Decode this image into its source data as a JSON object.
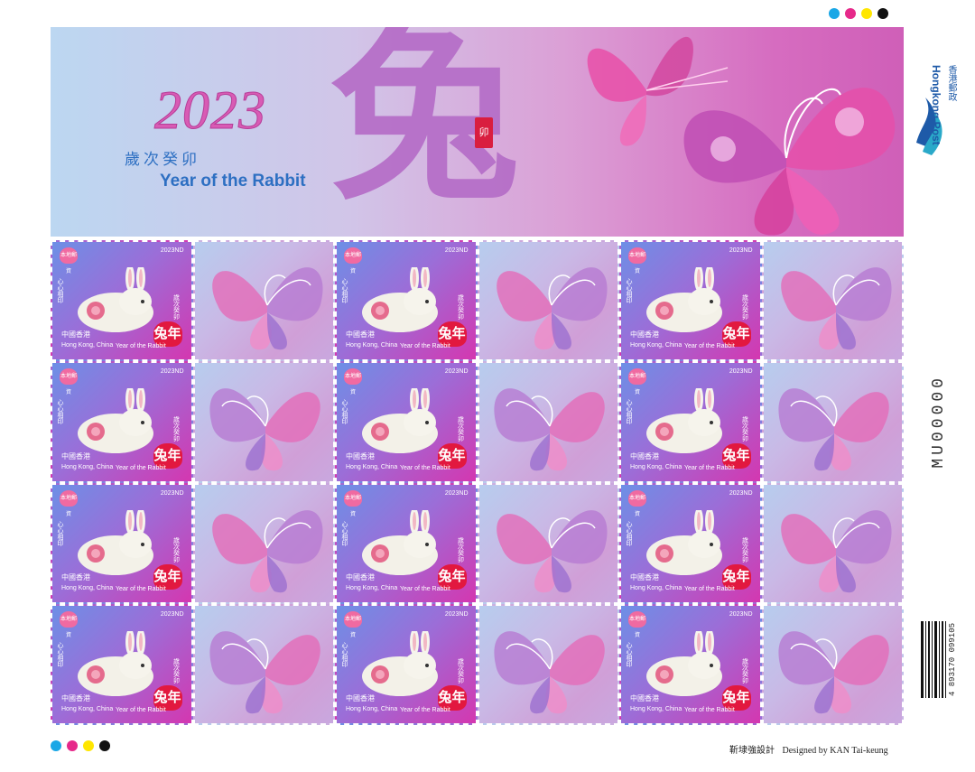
{
  "header": {
    "year": "2023",
    "cn_subtitle": "歲次癸卯",
    "en_subtitle": "Year of the Rabbit",
    "big_character": "兔",
    "seal_text": "卯"
  },
  "hongkong_post": {
    "logo_en": "Hongkong Post",
    "logo_cn": "香港郵政"
  },
  "serial_number": "MU00000",
  "barcode_number": "4 893170 099105",
  "credit": {
    "cn": "靳埭強設計",
    "en": "Designed by KAN Tai-keung"
  },
  "stamp": {
    "denomination": "2023ND",
    "heart_text": "本地郵資",
    "side_text": "心心相印",
    "location_cn": "中國香港",
    "location_en": "Hong Kong, China",
    "year_en": "Year of the Rabbit",
    "badge_top": "歲次癸卯",
    "badge": "兔年"
  },
  "colors": {
    "dot_cyan": "#1aa7e6",
    "dot_magenta": "#e6298a",
    "dot_yellow": "#ffe600",
    "dot_black": "#111111",
    "header_blue": "#2d6fc2",
    "header_pink": "#d85bb4"
  }
}
